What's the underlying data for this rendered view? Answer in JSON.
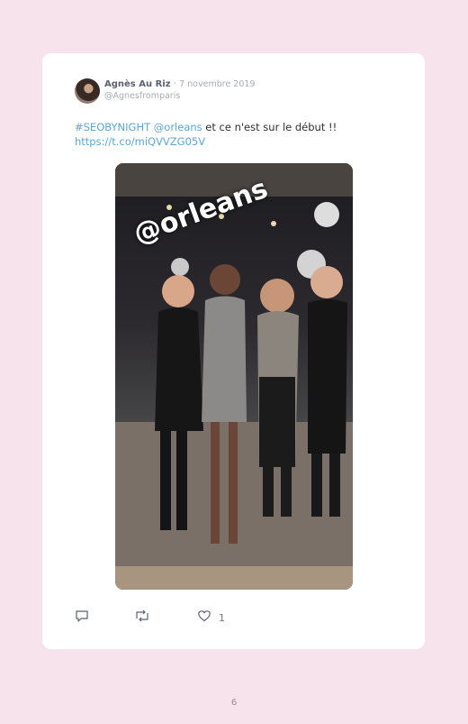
{
  "tweet": {
    "author_name": "Agnès Au Riz",
    "separator": "·",
    "date": "7 novembre 2019",
    "handle": "@Agnesfromparis",
    "hashtag": "#SEOBYNIGHT",
    "mention": "@orleans",
    "body_text": " et ce n'est sur le début !!",
    "url": "https://t.co/miQVVZG05V",
    "media_sticker": "@orleans",
    "like_count": "1"
  },
  "icons": {
    "reply": "reply-icon",
    "retweet": "retweet-icon",
    "like": "heart-icon"
  },
  "colors": {
    "page_background": "#f7e3ec",
    "link": "#5aa7d8",
    "card": "#ffffff"
  },
  "footer": {
    "page_number": "6"
  }
}
